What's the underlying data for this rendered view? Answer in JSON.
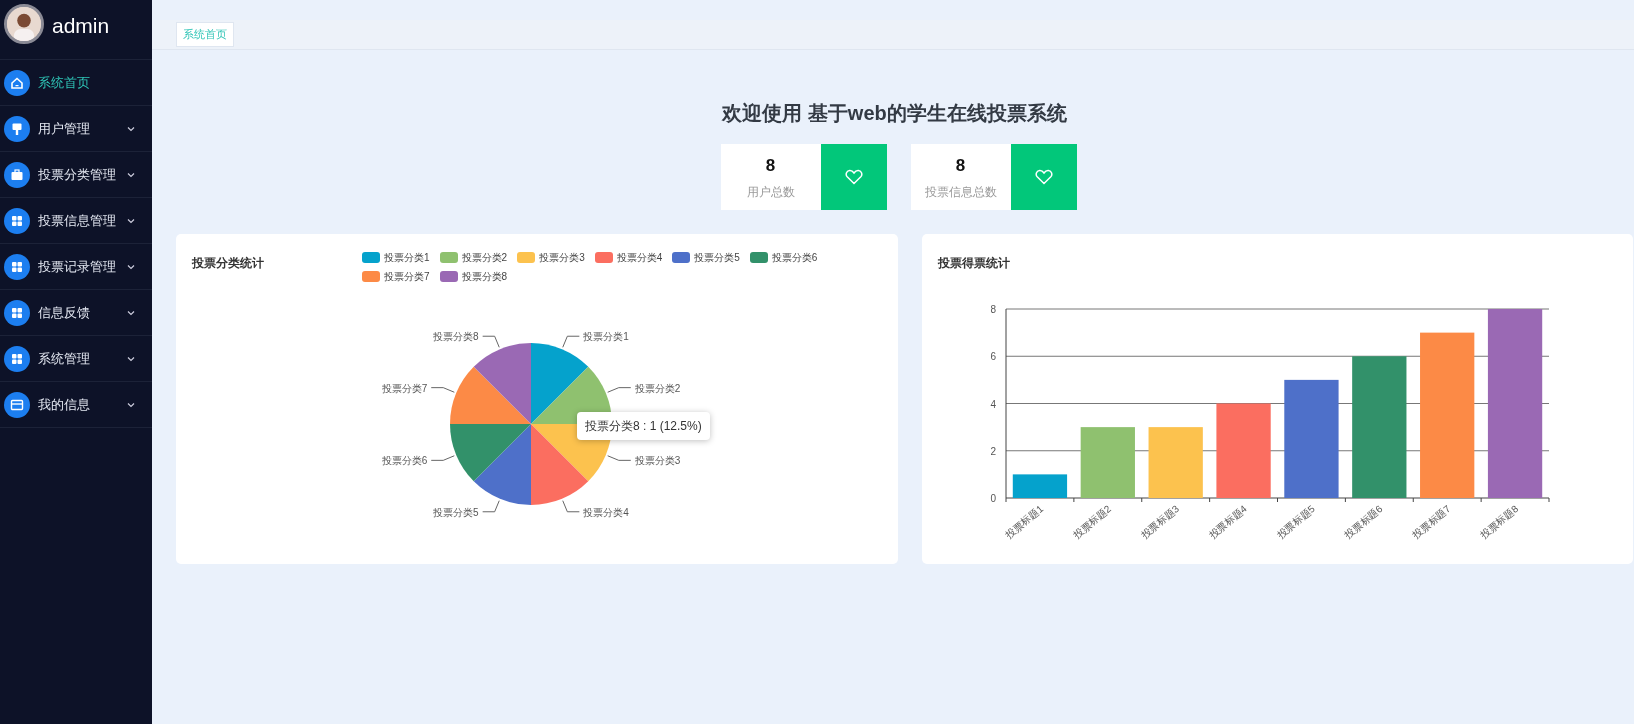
{
  "user": {
    "name": "admin"
  },
  "sidebar": {
    "items": [
      {
        "label": "系统首页",
        "kind": "home",
        "selected": true,
        "expandable": false
      },
      {
        "label": "用户管理",
        "kind": "brush",
        "selected": false,
        "expandable": true
      },
      {
        "label": "投票分类管理",
        "kind": "briefcase",
        "selected": false,
        "expandable": true
      },
      {
        "label": "投票信息管理",
        "kind": "grid",
        "selected": false,
        "expandable": true
      },
      {
        "label": "投票记录管理",
        "kind": "grid",
        "selected": false,
        "expandable": true
      },
      {
        "label": "信息反馈",
        "kind": "grid",
        "selected": false,
        "expandable": true
      },
      {
        "label": "系统管理",
        "kind": "grid",
        "selected": false,
        "expandable": true
      },
      {
        "label": "我的信息",
        "kind": "card",
        "selected": false,
        "expandable": true
      }
    ]
  },
  "tabs": [
    {
      "label": "系统首页",
      "selected": true
    }
  ],
  "welcome": "欢迎使用 基于web的学生在线投票系统",
  "stats": [
    {
      "value": "8",
      "label": "用户总数"
    },
    {
      "value": "8",
      "label": "投票信息总数"
    }
  ],
  "pie_card": {
    "legend": [
      {
        "label": "投票分类1",
        "color": "#05a2cc"
      },
      {
        "label": "投票分类2",
        "color": "#8fc16f"
      },
      {
        "label": "投票分类3",
        "color": "#fcc24e"
      },
      {
        "label": "投票分类4",
        "color": "#fb6e60"
      },
      {
        "label": "投票分类5",
        "color": "#4e70c9"
      },
      {
        "label": "投票分类6",
        "color": "#32916a"
      },
      {
        "label": "投票分类7",
        "color": "#fc8a46"
      },
      {
        "label": "投票分类8",
        "color": "#9a69b4"
      }
    ],
    "tooltip": "投票分类8 : 1 (12.5%)",
    "chart_data": {
      "type": "pie",
      "title": "投票分类统计",
      "categories": [
        "投票分类1",
        "投票分类2",
        "投票分类3",
        "投票分类4",
        "投票分类5",
        "投票分类6",
        "投票分类7",
        "投票分类8"
      ],
      "values": [
        12.5,
        12.5,
        12.5,
        12.5,
        12.5,
        12.5,
        12.5,
        12.5
      ]
    }
  },
  "bar_card": {
    "chart_data": {
      "type": "bar",
      "title": "投票得票统计",
      "categories": [
        "投票标题1",
        "投票标题2",
        "投票标题3",
        "投票标题4",
        "投票标题5",
        "投票标题6",
        "投票标题7",
        "投票标题8"
      ],
      "series": [
        {
          "values": [
            1,
            3,
            3,
            4,
            5,
            6,
            7,
            8
          ]
        }
      ],
      "colors": [
        "#05a2cc",
        "#8fc16f",
        "#fcc24e",
        "#fb6e60",
        "#4e70c9",
        "#32916a",
        "#fc8a46",
        "#9a69b4"
      ],
      "ylim": [
        0,
        8
      ],
      "yticks": [
        0,
        2,
        4,
        6,
        8
      ],
      "grid": true
    }
  }
}
